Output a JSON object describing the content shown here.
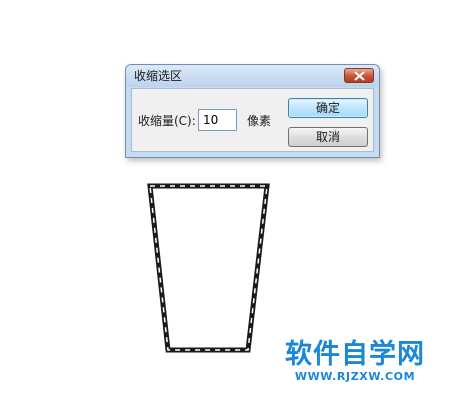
{
  "dialog": {
    "title": "收缩选区",
    "contract_label": "收缩量(C):",
    "contract_value": "10",
    "unit": "像素",
    "ok_label": "确定",
    "cancel_label": "取消"
  },
  "watermark": {
    "name": "软件自学网",
    "url": "WWW.RJZXW.COM"
  },
  "colors": {
    "watermark": "#1a87d8",
    "selection_border": "#1a1a1a",
    "close_button": "#c65436"
  }
}
